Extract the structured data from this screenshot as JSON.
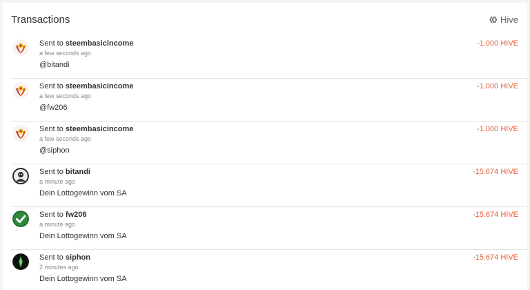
{
  "header": {
    "title": "Transactions",
    "network_label": "Hive"
  },
  "transactions": [
    {
      "avatar_icon": "steembasicincome-logo-icon",
      "prefix": "Sent to",
      "recipient": "steembasicincome",
      "time": "a few seconds ago",
      "memo": "@bitandi",
      "amount": "-1.000 HIVE"
    },
    {
      "avatar_icon": "steembasicincome-logo-icon",
      "prefix": "Sent to",
      "recipient": "steembasicincome",
      "time": "a few seconds ago",
      "memo": "@fw206",
      "amount": "-1.000 HIVE"
    },
    {
      "avatar_icon": "steembasicincome-logo-icon",
      "prefix": "Sent to",
      "recipient": "steembasicincome",
      "time": "a few seconds ago",
      "memo": "@siphon",
      "amount": "-1.000 HIVE"
    },
    {
      "avatar_icon": "bitandi-avatar-icon",
      "prefix": "Sent to",
      "recipient": "bitandi",
      "time": "a minute ago",
      "memo": "Dein Lottogewinn vom SA",
      "amount": "-15.674 HIVE"
    },
    {
      "avatar_icon": "green-checkmark-icon",
      "prefix": "Sent to",
      "recipient": "fw206",
      "time": "a minute ago",
      "memo": "Dein Lottogewinn vom SA",
      "amount": "-15.674 HIVE"
    },
    {
      "avatar_icon": "siphon-avatar-icon",
      "prefix": "Sent to",
      "recipient": "siphon",
      "time": "2 minutes ago",
      "memo": "Dein Lottogewinn vom SA",
      "amount": "-15.674 HIVE"
    }
  ],
  "colors": {
    "amount": "#e65c3a",
    "sbi_red": "#c0392b",
    "sbi_yellow": "#f1c40f",
    "check_green": "#2e8b3a"
  }
}
